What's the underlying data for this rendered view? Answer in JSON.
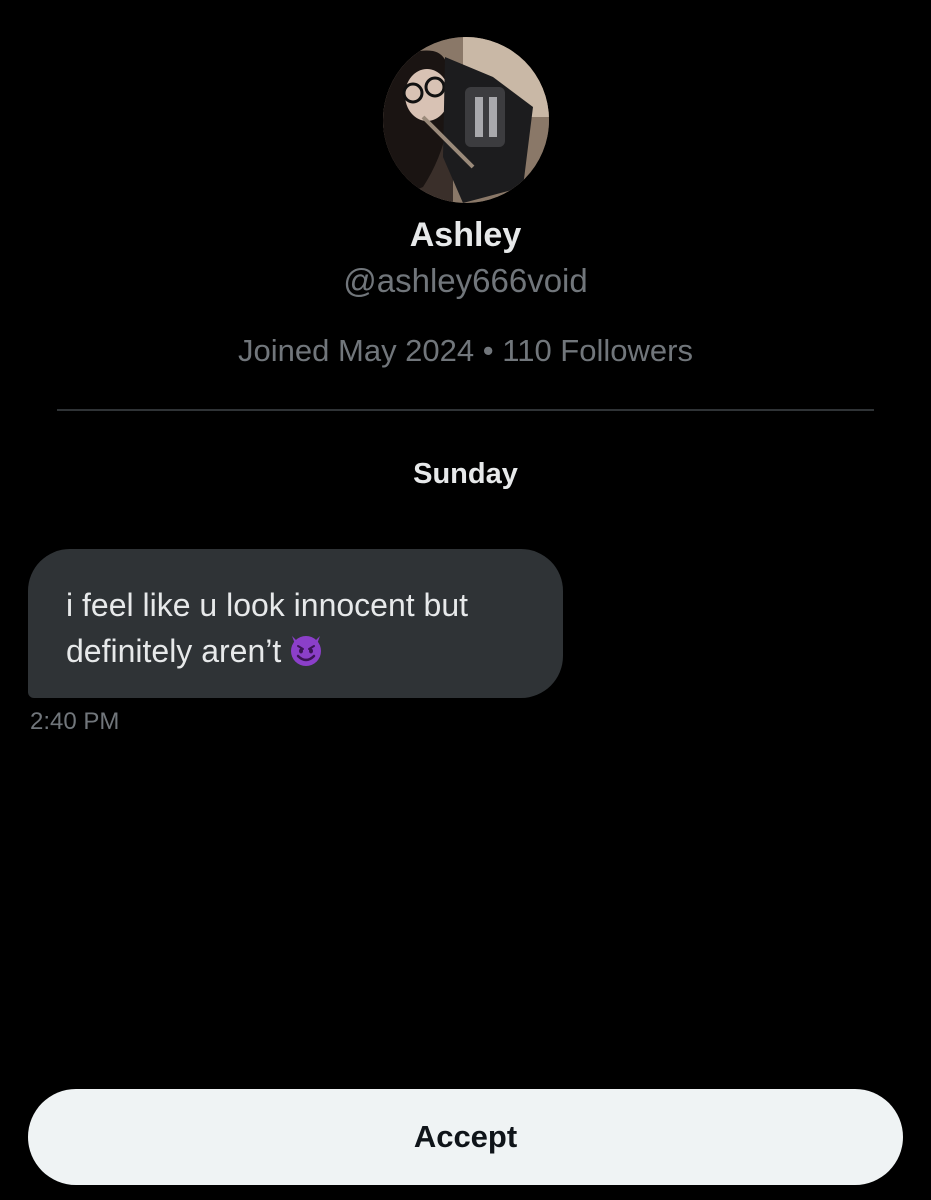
{
  "profile": {
    "name": "Ashley",
    "handle": "@ashley666void",
    "joined": "Joined May 2024",
    "separator": "•",
    "followers": "110 Followers",
    "avatar_icon": "profile-photo"
  },
  "conversation": {
    "day_label": "Sunday",
    "messages": [
      {
        "line1": "i feel like u look innocent but",
        "line2": "definitely aren’t",
        "emoji_icon": "smiling-devil-emoji",
        "time": "2:40 PM"
      }
    ]
  },
  "actions": {
    "accept_label": "Accept"
  },
  "colors": {
    "background": "#000000",
    "bubble": "#2f3336",
    "muted_text": "#71767b",
    "primary_text": "#e7e9ea",
    "button_bg": "#eff3f4",
    "button_text": "#0f1419",
    "emoji_purple": "#8b3fc9"
  }
}
